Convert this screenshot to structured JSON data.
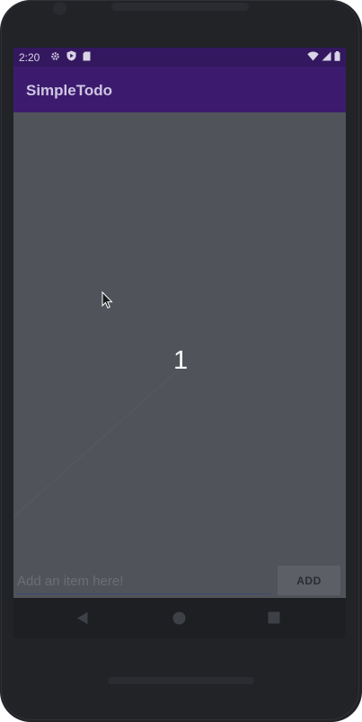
{
  "status_bar": {
    "time": "2:20",
    "left_icons": [
      "gear-icon",
      "play-protect-icon",
      "sd-card-icon"
    ],
    "right_icons": [
      "wifi-icon",
      "cellular-signal-icon",
      "battery-icon"
    ]
  },
  "app_bar": {
    "title": "SimpleTodo"
  },
  "list": {
    "items": [
      "1"
    ]
  },
  "input": {
    "placeholder": "Add an item here!",
    "value": ""
  },
  "add_button": {
    "label": "ADD"
  },
  "nav": {
    "buttons": [
      "back-icon",
      "home-icon",
      "recents-icon"
    ]
  },
  "colors": {
    "status_bar": "#34185f",
    "app_bar": "#3c1b6e",
    "screen_background": "#50545a",
    "device_frame": "#212327",
    "input_underline": "#3b4a73"
  }
}
